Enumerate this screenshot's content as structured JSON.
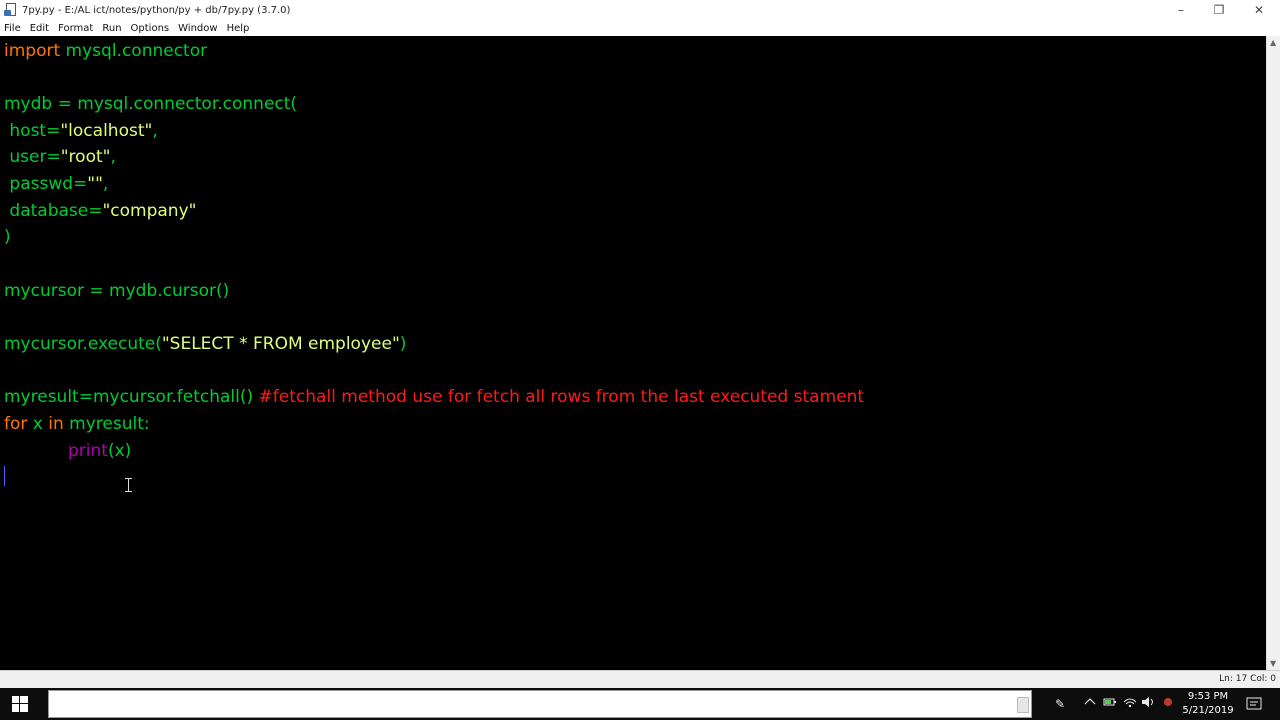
{
  "window": {
    "title": "7py.py - E:/AL ict/notes/python/py + db/7py.py (3.7.0)",
    "controls": {
      "minimize": "–",
      "restore": "❐",
      "close": "✕"
    }
  },
  "menu": [
    "File",
    "Edit",
    "Format",
    "Run",
    "Options",
    "Window",
    "Help"
  ],
  "code": {
    "l1_kw": "import",
    "l1_mod": " mysql.connector",
    "l2": "mydb = mysql.connector.connect(",
    "l3_a": " host=",
    "l3_s": "\"localhost\"",
    "l3_c": ",",
    "l4_a": " user=",
    "l4_s": "\"root\"",
    "l4_c": ",",
    "l5_a": " passwd=",
    "l5_s": "\"\"",
    "l5_c": ",",
    "l6_a": " database=",
    "l6_s": "\"company\"",
    "l7": ")",
    "l8": "mycursor = mydb.cursor()",
    "l9_a": "mycursor.execute(",
    "l9_s": "\"SELECT * FROM employee\"",
    "l9_c": ")",
    "l10_a": "myresult=mycursor.fetchall() ",
    "l10_comment": "#fetchall method use for fetch all rows from the last executed stament",
    "l11_kw1": "for",
    "l11_x": " x ",
    "l11_kw2": "in",
    "l11_rest": " myresult:",
    "l12_indent": "\t",
    "l12_bi": "print",
    "l12_rest": "(x)"
  },
  "status": {
    "position": "Ln: 17  Col: 0"
  },
  "taskbar": {
    "time": "9:53 PM",
    "date": "5/21/2019"
  },
  "icons": [
    "idle-app-icon",
    "windows-start-icon",
    "pen-icon",
    "chevron-up-icon",
    "battery-icon",
    "network-icon",
    "cloud-icon",
    "volume-icon",
    "record-icon",
    "notification-icon"
  ],
  "colors": {
    "keyword": "#ff7700",
    "identifier": "#00cc33",
    "string": "#dfff7a",
    "comment": "#ff1a1a",
    "builtin": "#b000b0",
    "editor_bg": "#000000"
  }
}
